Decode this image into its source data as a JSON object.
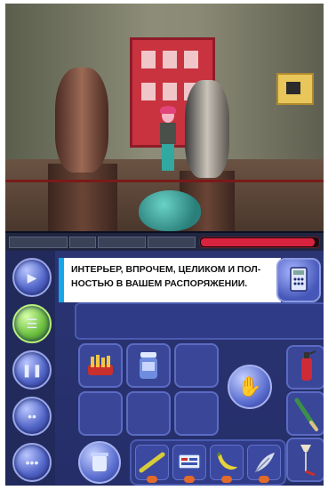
{
  "caption": {
    "line1": "ИНТЕРЬЕР, ВПРОЧЕМ, ЦЕЛИКОМ И ПОЛ-",
    "line2": "НОСТЬЮ В ВАШЕМ РАСПОРЯЖЕНИИ."
  },
  "status": {
    "meter_fraction": 0.97,
    "meter_color": "#d8233f"
  },
  "sidebar": {
    "buttons": [
      "play-icon",
      "checklist-icon",
      "pause-icon",
      "chat-icon",
      "more-icon"
    ]
  },
  "inventory": {
    "grid_items": [
      "fries-icon",
      "jar-icon"
    ],
    "tray_items": [
      "pencil-icon",
      "tag-icon",
      "banana-icon",
      "feather-icon"
    ],
    "tool_items": [
      "calculator-icon",
      "fire-extinguisher-icon",
      "brush-icon",
      "lamp-icon"
    ]
  },
  "colors": {
    "caption_accent": "#17a6e8",
    "panel": "#2b3574",
    "active_button": "#6cbf3f"
  }
}
